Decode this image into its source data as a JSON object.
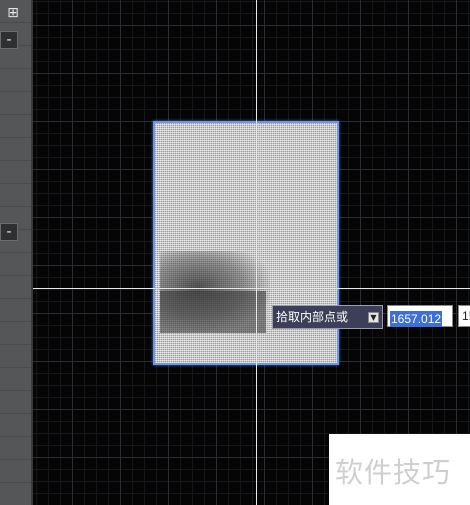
{
  "left_panel": {
    "top_icon": "multiple-lines-icon",
    "collapse_buttons": [
      "-",
      "-"
    ]
  },
  "canvas": {
    "prompt_text": "拾取内部点或",
    "prompt_dropdown_icon": "down-arrow-icon",
    "coordinate_x": "1657.012",
    "coordinate_y_partial": "1!",
    "colors": {
      "background": "#050506",
      "grid": "#2a2d33",
      "selection_border": "#6f95e6",
      "prompt_bg": "#3d3f58"
    }
  },
  "watermark": {
    "text": "软件技巧"
  }
}
